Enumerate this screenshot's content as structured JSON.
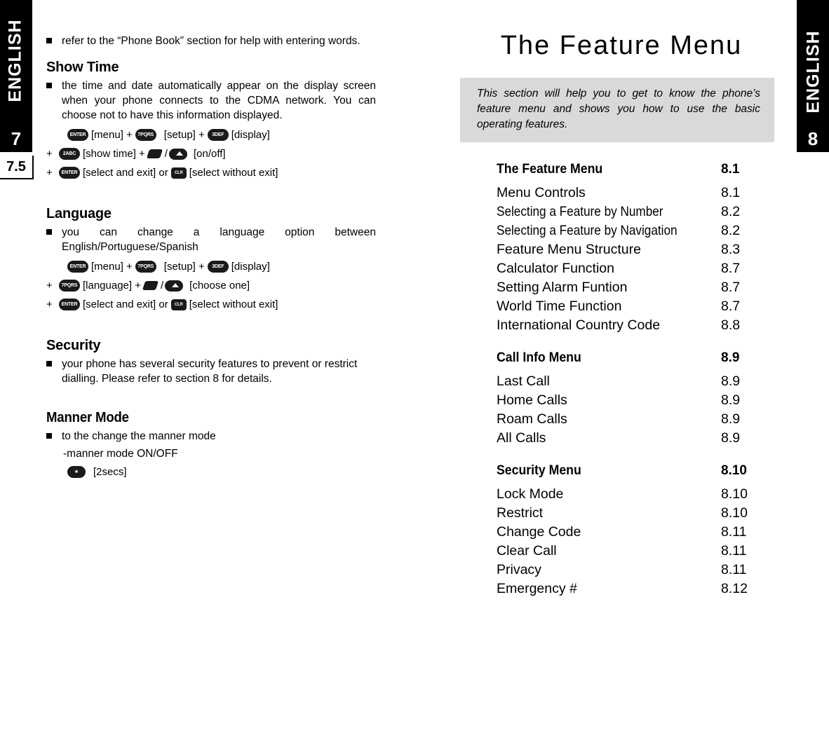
{
  "left_tab": {
    "language_label": "ENGLISH",
    "page_number": "7",
    "sub_number": "7.5"
  },
  "right_tab": {
    "language_label": "ENGLISH",
    "page_number": "8"
  },
  "left_page": {
    "intro_bullet": "refer to the “Phone Book” section for help with entering words.",
    "sections": [
      {
        "heading": "Show Time",
        "bullet": "the time and date automatically appear on the display screen when your phone connects to the CDMA network. You can choose not to have this information displayed.",
        "steps": [
          {
            "indent": "",
            "parts": [
              "[menu] +",
              "[setup] +",
              "[display]"
            ],
            "keys": [
              "ENTER",
              "7PQRS",
              "3DEF"
            ]
          },
          {
            "indent": "+",
            "parts": [
              "[show time] +",
              "/",
              "[on/off]"
            ],
            "keys": [
              "2ABC",
              "nav-left",
              "nav-up"
            ]
          },
          {
            "indent": "+",
            "parts": [
              "[select and exit] or",
              "[select without exit]"
            ],
            "keys": [
              "ENTER",
              "CLR"
            ]
          }
        ]
      },
      {
        "heading": "Language",
        "bullet": "you can change a language option between English/Portuguese/Spanish",
        "steps": [
          {
            "indent": "",
            "parts": [
              "[menu] +",
              "[setup] +",
              "[display]"
            ],
            "keys": [
              "ENTER",
              "7PQRS",
              "3DEF"
            ]
          },
          {
            "indent": "+",
            "parts": [
              "[language] +",
              "/",
              "[choose one]"
            ],
            "keys": [
              "7PQRS",
              "nav-left",
              "nav-up"
            ]
          },
          {
            "indent": "+",
            "parts": [
              "[select and exit] or",
              "[select without exit]"
            ],
            "keys": [
              "ENTER",
              "CLR"
            ]
          }
        ]
      },
      {
        "heading": "Security",
        "bullet": "your phone has several security features to prevent or restrict dialling. Please refer to section 8 for details.",
        "steps": []
      },
      {
        "heading": "Manner Mode",
        "bullet": "to the change the manner mode",
        "sub_line": "-manner mode ON/OFF",
        "steps": [
          {
            "indent": "",
            "parts": [
              "[2secs]"
            ],
            "keys": [
              "*"
            ]
          }
        ]
      }
    ]
  },
  "right_page": {
    "title": "The Feature Menu",
    "intro": "This section will help you to get to know the phone’s feature menu and shows you how to use the basic operating features.",
    "toc": [
      {
        "heading": "The Feature Menu",
        "heading_num": "8.1",
        "rows": [
          {
            "label": "Menu Controls",
            "num": "8.1",
            "condensed": false
          },
          {
            "label": "Selecting a Feature by Number",
            "num": "8.2",
            "condensed": true
          },
          {
            "label": "Selecting a Feature by Navigation",
            "num": "8.2",
            "condensed": true
          },
          {
            "label": "Feature Menu Structure",
            "num": "8.3",
            "condensed": false
          },
          {
            "label": "Calculator Function",
            "num": "8.7",
            "condensed": false
          },
          {
            "label": "Setting Alarm Funtion",
            "num": "8.7",
            "condensed": false
          },
          {
            "label": "World Time Function",
            "num": "8.7",
            "condensed": false
          },
          {
            "label": "International Country Code",
            "num": "8.8",
            "condensed": false
          }
        ]
      },
      {
        "heading": "Call Info Menu",
        "heading_num": "8.9",
        "rows": [
          {
            "label": "Last Call",
            "num": "8.9",
            "condensed": false
          },
          {
            "label": "Home Calls",
            "num": "8.9",
            "condensed": false
          },
          {
            "label": "Roam Calls",
            "num": "8.9",
            "condensed": false
          },
          {
            "label": "All Calls",
            "num": "8.9",
            "condensed": false
          }
        ]
      },
      {
        "heading": "Security Menu",
        "heading_num": "8.10",
        "rows": [
          {
            "label": "Lock Mode",
            "num": "8.10",
            "condensed": false
          },
          {
            "label": "Restrict",
            "num": "8.10",
            "condensed": false
          },
          {
            "label": "Change Code",
            "num": "8.11",
            "condensed": false
          },
          {
            "label": "Clear Call",
            "num": "8.11",
            "condensed": false
          },
          {
            "label": "Privacy",
            "num": "8.11",
            "condensed": false
          },
          {
            "label": "Emergency #",
            "num": "8.12",
            "condensed": false
          }
        ]
      }
    ]
  },
  "keys": {
    "enter": "ENTER",
    "seven": "7PQRS",
    "three": "3DEF",
    "two": "2ABC",
    "clr": "CLR",
    "star": "∗"
  }
}
